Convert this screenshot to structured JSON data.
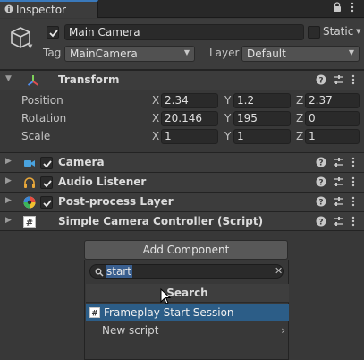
{
  "tab": {
    "title": "Inspector",
    "icon": "info-icon"
  },
  "header": {
    "object_name": "Main Camera",
    "static_label": "Static",
    "tag_label": "Tag",
    "tag_value": "MainCamera",
    "layer_label": "Layer",
    "layer_value": "Default"
  },
  "transform": {
    "title": "Transform",
    "rows": [
      {
        "label": "Position",
        "x": "2.34",
        "y": "1.2",
        "z": "2.37"
      },
      {
        "label": "Rotation",
        "x": "20.146",
        "y": "195",
        "z": "0"
      },
      {
        "label": "Scale",
        "x": "1",
        "y": "1",
        "z": "1"
      }
    ],
    "axes": {
      "x": "X",
      "y": "Y",
      "z": "Z"
    }
  },
  "components": [
    {
      "title": "Camera",
      "icon": "camera-icon"
    },
    {
      "title": "Audio Listener",
      "icon": "headphones-icon"
    },
    {
      "title": "Post-process Layer",
      "icon": "post-process-icon"
    },
    {
      "title": "Simple Camera Controller (Script)",
      "icon": "script-icon"
    }
  ],
  "add_component": {
    "button_label": "Add Component",
    "search_value": "start",
    "popup_title": "Search",
    "results": [
      {
        "label": "Frameplay Start Session",
        "icon": "script-icon",
        "selected": true
      },
      {
        "label": "New script",
        "icon": "chevron-right-icon",
        "selected": false
      }
    ]
  },
  "colors": {
    "background": "#383838",
    "header_bg": "#3c3c3c",
    "selection": "#2c5d87",
    "tab_accent": "#3a79bb"
  }
}
